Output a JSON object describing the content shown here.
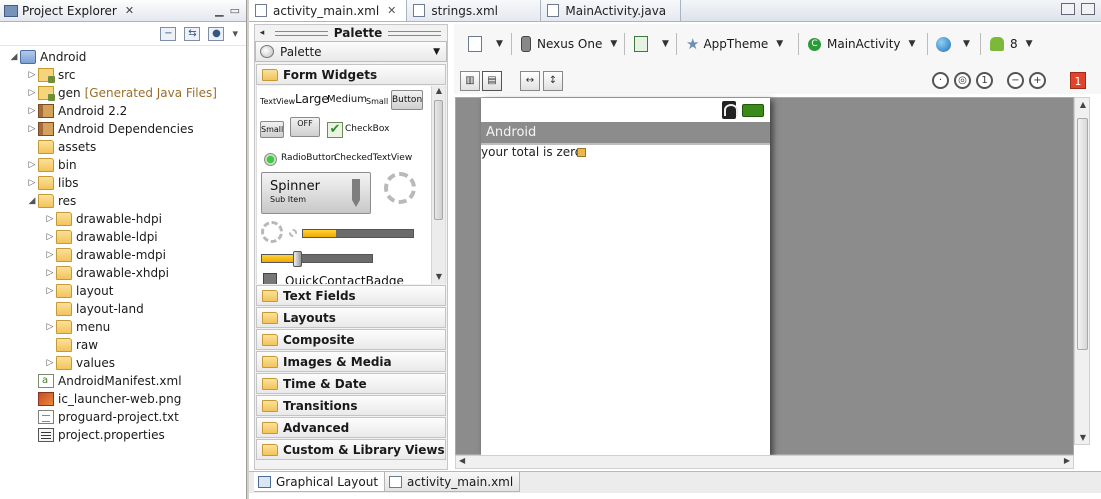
{
  "explorer": {
    "title": "Project Explorer",
    "close_glyph": "✕",
    "menu_glyph": "▾",
    "tree": [
      {
        "label": "Android",
        "depth": 0,
        "arrow": "◢",
        "icon": "project-icon",
        "kind": "project"
      },
      {
        "label": "src",
        "depth": 1,
        "arrow": "▷",
        "icon": "source-folder-icon",
        "kind": "src"
      },
      {
        "label": "gen",
        "note": "[Generated Java Files]",
        "depth": 1,
        "arrow": "▷",
        "icon": "source-folder-icon",
        "kind": "src"
      },
      {
        "label": "Android 2.2",
        "depth": 1,
        "arrow": "▷",
        "icon": "library-icon",
        "kind": "lib"
      },
      {
        "label": "Android Dependencies",
        "depth": 1,
        "arrow": "▷",
        "icon": "library-icon",
        "kind": "lib"
      },
      {
        "label": "assets",
        "depth": 1,
        "arrow": "",
        "icon": "folder-icon",
        "kind": "folder"
      },
      {
        "label": "bin",
        "depth": 1,
        "arrow": "▷",
        "icon": "folder-icon",
        "kind": "folder"
      },
      {
        "label": "libs",
        "depth": 1,
        "arrow": "▷",
        "icon": "folder-icon",
        "kind": "folder"
      },
      {
        "label": "res",
        "depth": 1,
        "arrow": "◢",
        "icon": "folder-icon",
        "kind": "folder"
      },
      {
        "label": "drawable-hdpi",
        "depth": 2,
        "arrow": "▷",
        "icon": "folder-icon",
        "kind": "folder"
      },
      {
        "label": "drawable-ldpi",
        "depth": 2,
        "arrow": "▷",
        "icon": "folder-icon",
        "kind": "folder"
      },
      {
        "label": "drawable-mdpi",
        "depth": 2,
        "arrow": "▷",
        "icon": "folder-icon",
        "kind": "folder"
      },
      {
        "label": "drawable-xhdpi",
        "depth": 2,
        "arrow": "▷",
        "icon": "folder-icon",
        "kind": "folder"
      },
      {
        "label": "layout",
        "depth": 2,
        "arrow": "▷",
        "icon": "folder-icon",
        "kind": "folder"
      },
      {
        "label": "layout-land",
        "depth": 2,
        "arrow": "",
        "icon": "folder-icon",
        "kind": "folder"
      },
      {
        "label": "menu",
        "depth": 2,
        "arrow": "▷",
        "icon": "folder-icon",
        "kind": "folder"
      },
      {
        "label": "raw",
        "depth": 2,
        "arrow": "",
        "icon": "folder-icon",
        "kind": "folder"
      },
      {
        "label": "values",
        "depth": 2,
        "arrow": "▷",
        "icon": "folder-icon",
        "kind": "folder"
      },
      {
        "label": "AndroidManifest.xml",
        "depth": 1,
        "arrow": "",
        "icon": "xml-file-icon",
        "kind": "file-xml"
      },
      {
        "label": "ic_launcher-web.png",
        "depth": 1,
        "arrow": "",
        "icon": "image-file-icon",
        "kind": "file-png"
      },
      {
        "label": "proguard-project.txt",
        "depth": 1,
        "arrow": "",
        "icon": "text-file-icon",
        "kind": "file-txt"
      },
      {
        "label": "project.properties",
        "depth": 1,
        "arrow": "",
        "icon": "properties-file-icon",
        "kind": "file-props"
      }
    ]
  },
  "editor": {
    "tabs": [
      {
        "label": "activity_main.xml",
        "active": true,
        "closable": true
      },
      {
        "label": "strings.xml",
        "active": false,
        "closable": false
      },
      {
        "label": "MainActivity.java",
        "active": false,
        "closable": false
      }
    ],
    "close_glyph": "✕"
  },
  "palette": {
    "title": "Palette",
    "dropdown_label": "Palette",
    "collapse_glyph": "◂",
    "dropdown_glyph": "▼",
    "open_category": "Form Widgets",
    "widgets": {
      "textview": "TextView",
      "large": "Large",
      "medium": "Medium",
      "small": "Small",
      "button": "Button",
      "small_button": "Small",
      "toggle": "OFF",
      "checkbox": "CheckBox",
      "radio": "RadioButton",
      "checked_text": "CheckedTextView",
      "spinner": "Spinner",
      "spinner_sub": "Sub Item",
      "quick_contact": "QuickContactBadge",
      "progress_value": 0.3,
      "seek_value": 0.32,
      "check_glyph": "✔"
    },
    "categories": [
      "Text Fields",
      "Layouts",
      "Composite",
      "Images & Media",
      "Time & Date",
      "Transitions",
      "Advanced",
      "Custom & Library Views"
    ]
  },
  "design_toolbar": {
    "device": "Nexus One",
    "theme": "AppTheme",
    "activity": "MainActivity",
    "api_level": "8",
    "dropdown_glyph": "▼",
    "warning_count": "1"
  },
  "device_preview": {
    "app_title": "Android",
    "text": "your total is zero"
  },
  "bottom_tabs": [
    {
      "label": "Graphical Layout",
      "active": true
    },
    {
      "label": "activity_main.xml",
      "active": false
    }
  ],
  "colors": {
    "accent": "#f2a900",
    "canvas": "#8c8c8c",
    "action_bar": "#8c8c8c"
  }
}
